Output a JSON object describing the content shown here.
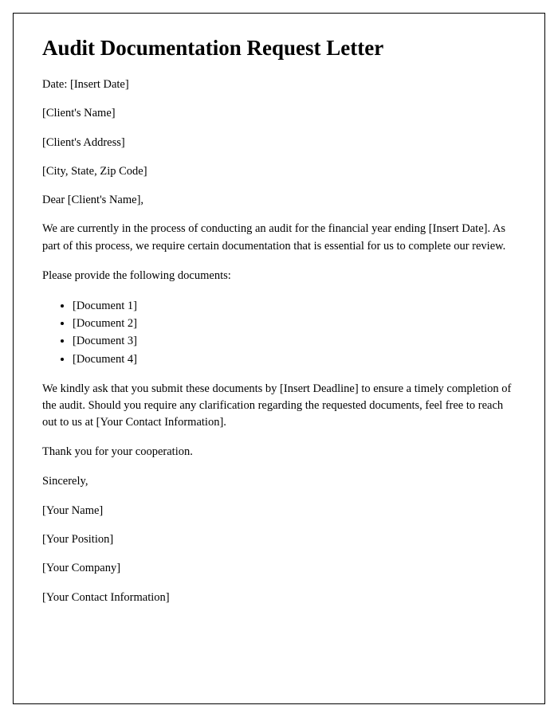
{
  "title": "Audit Documentation Request Letter",
  "date_line": "Date: [Insert Date]",
  "client_name": "[Client's Name]",
  "client_address": "[Client's Address]",
  "client_city": "[City, State, Zip Code]",
  "salutation": "Dear [Client's Name],",
  "body1": "We are currently in the process of conducting an audit for the financial year ending [Insert Date]. As part of this process, we require certain documentation that is essential for us to complete our review.",
  "body2": "Please provide the following documents:",
  "documents": [
    "[Document 1]",
    "[Document 2]",
    "[Document 3]",
    "[Document 4]"
  ],
  "body3": "We kindly ask that you submit these documents by [Insert Deadline] to ensure a timely completion of the audit. Should you require any clarification regarding the requested documents, feel free to reach out to us at [Your Contact Information].",
  "thanks": "Thank you for your cooperation.",
  "closing": "Sincerely,",
  "signer_name": "[Your Name]",
  "signer_position": "[Your Position]",
  "signer_company": "[Your Company]",
  "signer_contact": "[Your Contact Information]"
}
